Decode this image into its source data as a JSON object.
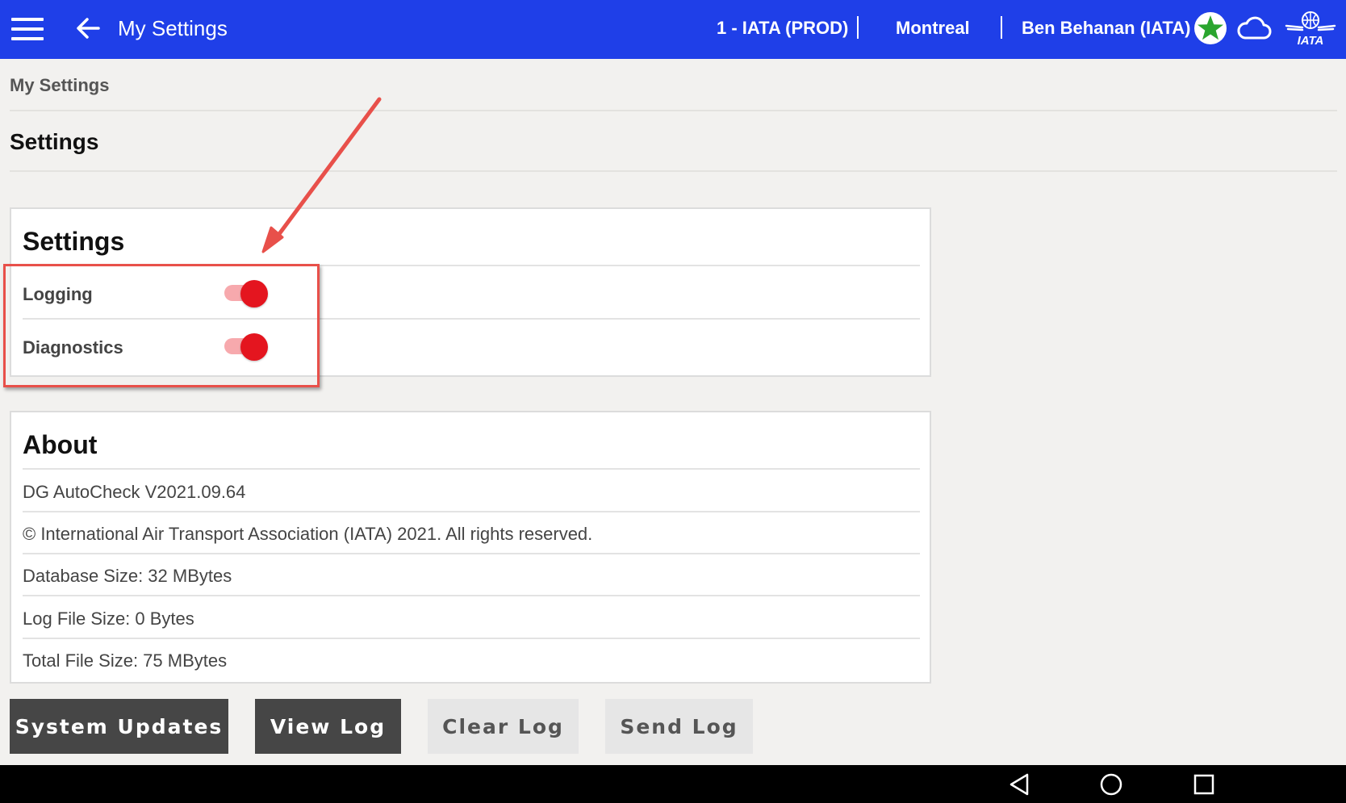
{
  "header": {
    "title": "My Settings",
    "environment": "1 - IATA (PROD)",
    "location": "Montreal",
    "user": "Ben Behanan (IATA)",
    "logo_text": "IATA",
    "icons": [
      "menu-icon",
      "back-arrow-icon",
      "star-status-icon",
      "cloud-icon",
      "iata-logo"
    ],
    "bar_color": "#1f3fe8",
    "status_color": "#2aa52e"
  },
  "breadcrumb": "My Settings",
  "page_title": "Settings",
  "settings_card": {
    "title": "Settings",
    "items": [
      {
        "label": "Logging",
        "enabled": true
      },
      {
        "label": "Diagnostics",
        "enabled": true
      }
    ],
    "toggle_color": "#e4151f"
  },
  "about_card": {
    "title": "About",
    "items": [
      "DG AutoCheck V2021.09.64",
      "© International Air Transport Association (IATA) 2021. All rights reserved.",
      "Database Size: 32 MBytes",
      "Log File Size: 0 Bytes",
      "Total File Size: 75 MBytes"
    ]
  },
  "buttons": {
    "system_updates": "System Updates",
    "view_log": "View Log",
    "clear_log": "Clear Log",
    "send_log": "Send Log"
  },
  "nav": {
    "icons": [
      "nav-back-icon",
      "nav-home-icon",
      "nav-recents-icon"
    ]
  },
  "annotation": {
    "color": "#e8504a"
  }
}
